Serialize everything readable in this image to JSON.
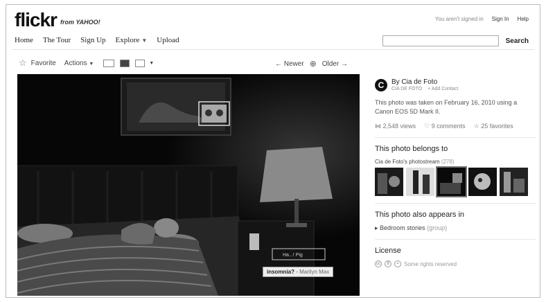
{
  "header": {
    "logo": "flickr",
    "logo_sub": "from YAHOO!",
    "nav": [
      {
        "label": "Home"
      },
      {
        "label": "The Tour"
      },
      {
        "label": "Sign Up"
      },
      {
        "label": "Explore"
      },
      {
        "label": "Upload"
      }
    ],
    "signed_in_text": "You aren't signed in",
    "sign_in": "Sign In",
    "help": "Help",
    "search_value": "",
    "search_button": "Search"
  },
  "toolbar": {
    "favorite": "Favorite",
    "actions": "Actions",
    "newer": "← Newer",
    "older": "Older →"
  },
  "photo": {
    "note_small": "Ha...! Pig",
    "note_title": "insomnia?",
    "note_sep": " - ",
    "note_author": "Marilyn Max"
  },
  "sidebar": {
    "author_initial": "C",
    "author_by": "By Cia de Foto",
    "author_handle": "CIA DE FOTO",
    "add_contact": "+ Add Contact",
    "taken_text": "This photo was taken on February 16, 2010 using a Canon EOS 5D Mark II.",
    "views": "2,548 views",
    "comments": "9 comments",
    "favorites": "25 favorites",
    "belongs_title": "This photo belongs to",
    "stream_label": "Cia de Foto's photostream",
    "stream_count": "(278)",
    "appears_title": "This photo also appears in",
    "group_name": "Bedroom stories",
    "group_tag": "(group)",
    "license_title": "License",
    "license_text": "Some rights reserved"
  },
  "colors": {
    "photo_bg": "#050505",
    "accent": "#222222"
  }
}
